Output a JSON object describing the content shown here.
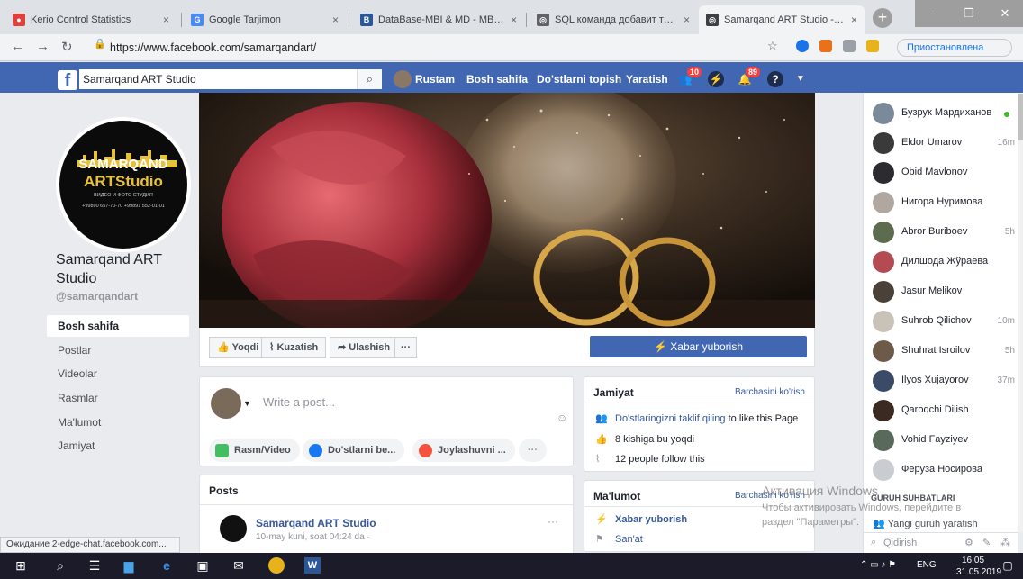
{
  "browser": {
    "tabs": [
      {
        "title": "Kerio Control Statistics",
        "close": "×",
        "favicon_color": "#e0403a"
      },
      {
        "title": "Google Tarjimon",
        "close": "×",
        "favicon_color": "#4a8af4"
      },
      {
        "title": "DataBase-MBI & MD - MBBLin",
        "close": "×",
        "favicon_color": "#2b5797"
      },
      {
        "title": "SQL команда добавит таблица",
        "close": "×",
        "favicon_color": "#5f6368"
      },
      {
        "title": "Samarqand ART Studio - Bosh",
        "close": "×",
        "favicon_color": "#3c4043"
      }
    ],
    "url": "https://www.facebook.com/samarqandart/",
    "paused_label": "Приостановлена",
    "status_text": "Ожидание 2-edge-chat.facebook.com..."
  },
  "fb_header": {
    "search_value": "Samarqand ART Studio",
    "user_name": "Rustam",
    "nav": [
      "Bosh sahifa",
      "Do'stlarni topish",
      "Yaratish"
    ],
    "badges": {
      "friends": "10",
      "notifications": "89"
    }
  },
  "page": {
    "profile_logo": {
      "line1": "SAMARQAND",
      "line2": "ARTStudio",
      "line3": "ВИДЕО И ФОТО СТУДИЯ",
      "line4": "+99890 657-70-70  +99891 552-01-01"
    },
    "name": "Samarqand ART Studio",
    "handle": "@samarqandart",
    "left_nav": [
      "Bosh sahifa",
      "Postlar",
      "Videolar",
      "Rasmlar",
      "Ma'lumot",
      "Jamiyat"
    ],
    "actions": {
      "like": "Yoqdi",
      "follow": "Kuzatish",
      "share": "Ulashish",
      "more": "···",
      "message": "Xabar yuborish"
    }
  },
  "composer": {
    "placeholder": "Write a post...",
    "chips": [
      "Rasm/Video",
      "Do'stlarni be...",
      "Joylashuvni ...",
      "···"
    ]
  },
  "posts": {
    "title": "Posts",
    "first": {
      "author": "Samarqand ART Studio",
      "meta": "10-may kuni, soat 04:24 da ·",
      "more": "···"
    }
  },
  "community": {
    "title": "Jamiyat",
    "see_all": "Barchasini ko'rish",
    "invite_link": "Do'stlaringizni taklif qiling",
    "invite_rest": " to like this Page",
    "likes": "8 kishiga bu yoqdi",
    "follows": "12 people follow this"
  },
  "about": {
    "title": "Ma'lumot",
    "see_all": "Barchasini ko'rish",
    "message": "Xabar yuborish",
    "category": "San'at"
  },
  "chat": {
    "contacts": [
      {
        "name": "Бузрук Мардиханов",
        "time": "",
        "online": true,
        "color": "#7a8a9a"
      },
      {
        "name": "Eldor Umarov",
        "time": "16m",
        "online": false,
        "color": "#3a3a3a"
      },
      {
        "name": "Obid Mavlonov",
        "time": "",
        "online": false,
        "color": "#2c2c30"
      },
      {
        "name": "Нигора Нуримова",
        "time": "",
        "online": false,
        "color": "#b0a8a0"
      },
      {
        "name": "Abror Buriboev",
        "time": "5h",
        "online": false,
        "color": "#5d6b4e"
      },
      {
        "name": "Дилшода Жўраева",
        "time": "",
        "online": false,
        "color": "#b44a52"
      },
      {
        "name": "Jasur Melikov",
        "time": "",
        "online": false,
        "color": "#4a4238"
      },
      {
        "name": "Suhrob Qilichov",
        "time": "10m",
        "online": false,
        "color": "#c8c2b8"
      },
      {
        "name": "Shuhrat Isroilov",
        "time": "5h",
        "online": false,
        "color": "#6e5a48"
      },
      {
        "name": "Ilyos Xujayorov",
        "time": "37m",
        "online": false,
        "color": "#3b4a66"
      },
      {
        "name": "Qaroqchi Dilish",
        "time": "",
        "online": false,
        "color": "#3a2a20"
      },
      {
        "name": "Vohid Fayziyev",
        "time": "",
        "online": false,
        "color": "#5a6a5a"
      },
      {
        "name": "Феруза Носирова",
        "time": "",
        "online": false,
        "color": "#c9ccd1"
      }
    ],
    "groups_title": "GURUH SUHBATLARI",
    "create_group": "Yangi guruh yaratish",
    "search_placeholder": "Qidirish"
  },
  "watermark": {
    "line1": "Активация Windows",
    "line2": "Чтобы активировать Windows, перейдите в",
    "line3": "раздел \"Параметры\"."
  },
  "taskbar": {
    "lang": "ENG",
    "time": "16:05",
    "date": "31.05.2019"
  },
  "colors": {
    "fb_blue": "#4267b2",
    "online": "#42b72a",
    "badge": "#fa3e3e",
    "link": "#385898"
  }
}
